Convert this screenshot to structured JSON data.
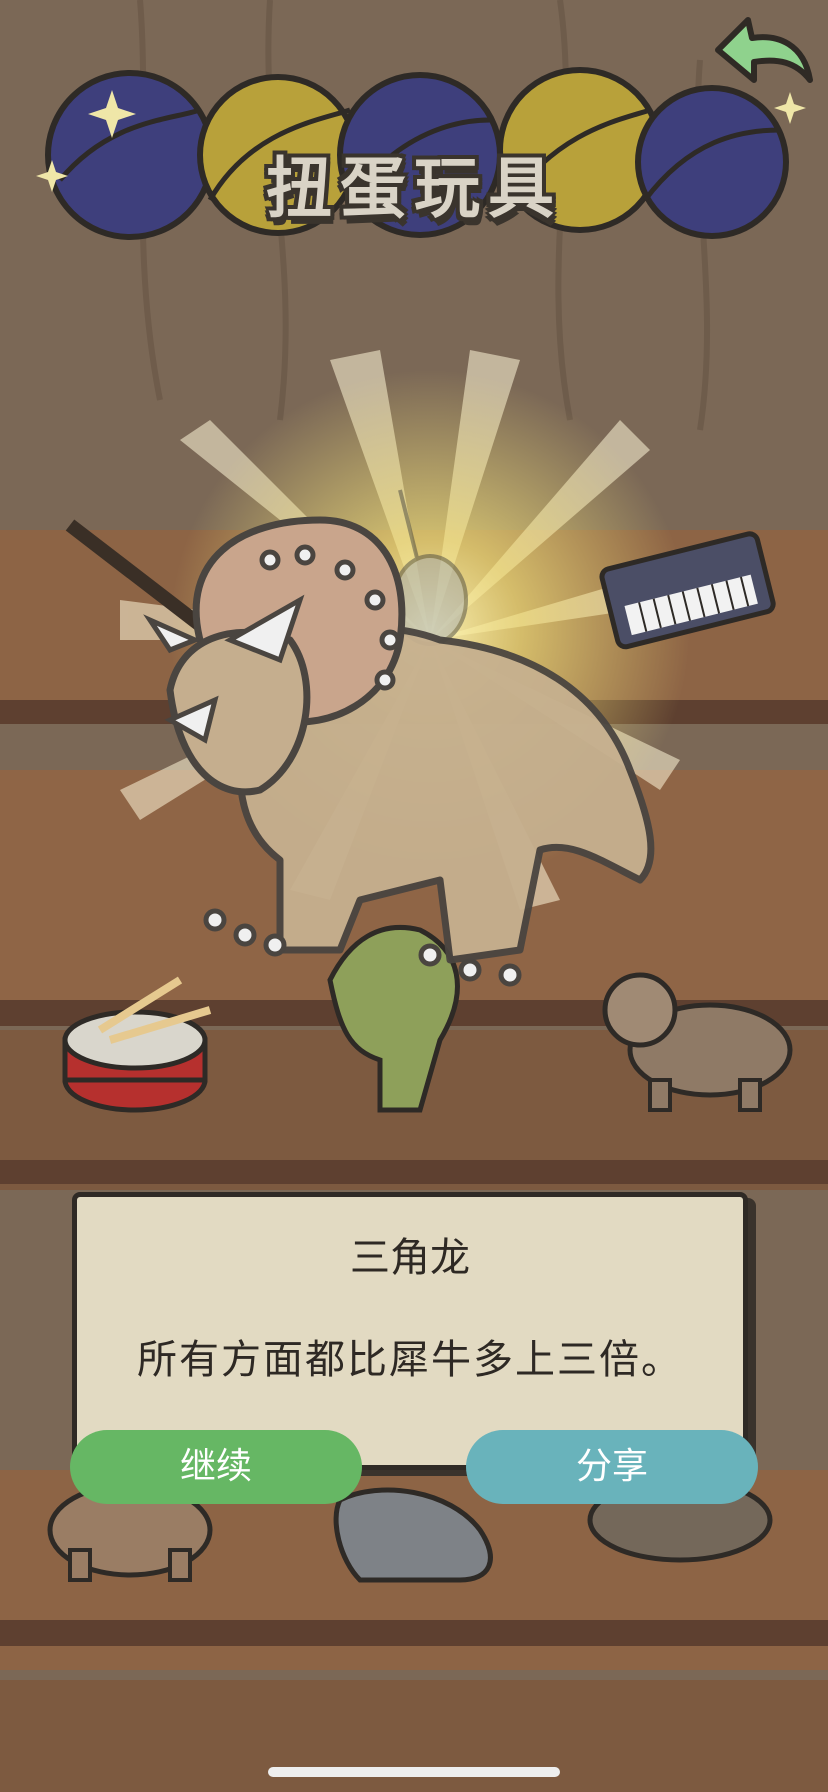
{
  "header": {
    "title": "扭蛋玩具",
    "back_icon": "back-arrow-icon"
  },
  "dialog": {
    "title": "三角龙",
    "description": "所有方面都比犀牛多上三倍。"
  },
  "buttons": {
    "continue_label": "继续",
    "share_label": "分享"
  },
  "shelf_items": [
    "drum-icon",
    "t-rex-icon",
    "triceratops-icon",
    "flute-icon",
    "guitar-icon",
    "keyboard-icon",
    "stegosaurus-icon",
    "parasaurolophus-icon",
    "ankylosaurus-icon"
  ],
  "colors": {
    "continue": "#66b764",
    "share": "#69b3bb",
    "dialog_bg": "#e2dac2"
  }
}
